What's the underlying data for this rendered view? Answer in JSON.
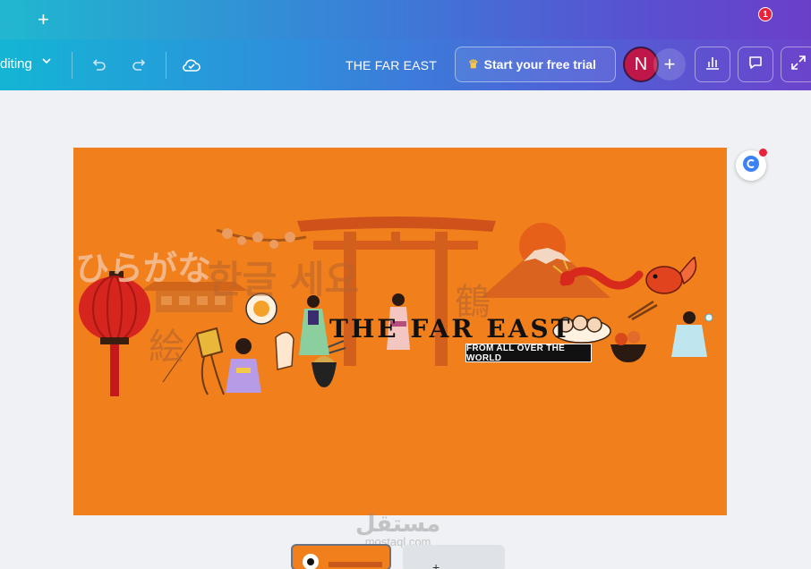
{
  "tabbar": {
    "close_icon": "×",
    "new_tab_icon": "+"
  },
  "toolbar": {
    "mode_label": "diting",
    "title": "THE FAR EAST",
    "trial_label": "Start your free trial",
    "avatar_initial": "N",
    "add_icon": "+",
    "comments_badge": "1"
  },
  "design": {
    "title": "THE FAR EAST",
    "subtitle": "FROM ALL OVER THE WORLD",
    "hiragana_text": "ひらがな",
    "korean_text": "한글 세요",
    "kanji_e": "絵",
    "kanji_tsuru": "鶴",
    "background_color": "#f07f1c"
  },
  "watermark": {
    "main": "مستقل",
    "sub": "mostaql.com"
  },
  "pages": {
    "add_icon": "+"
  }
}
